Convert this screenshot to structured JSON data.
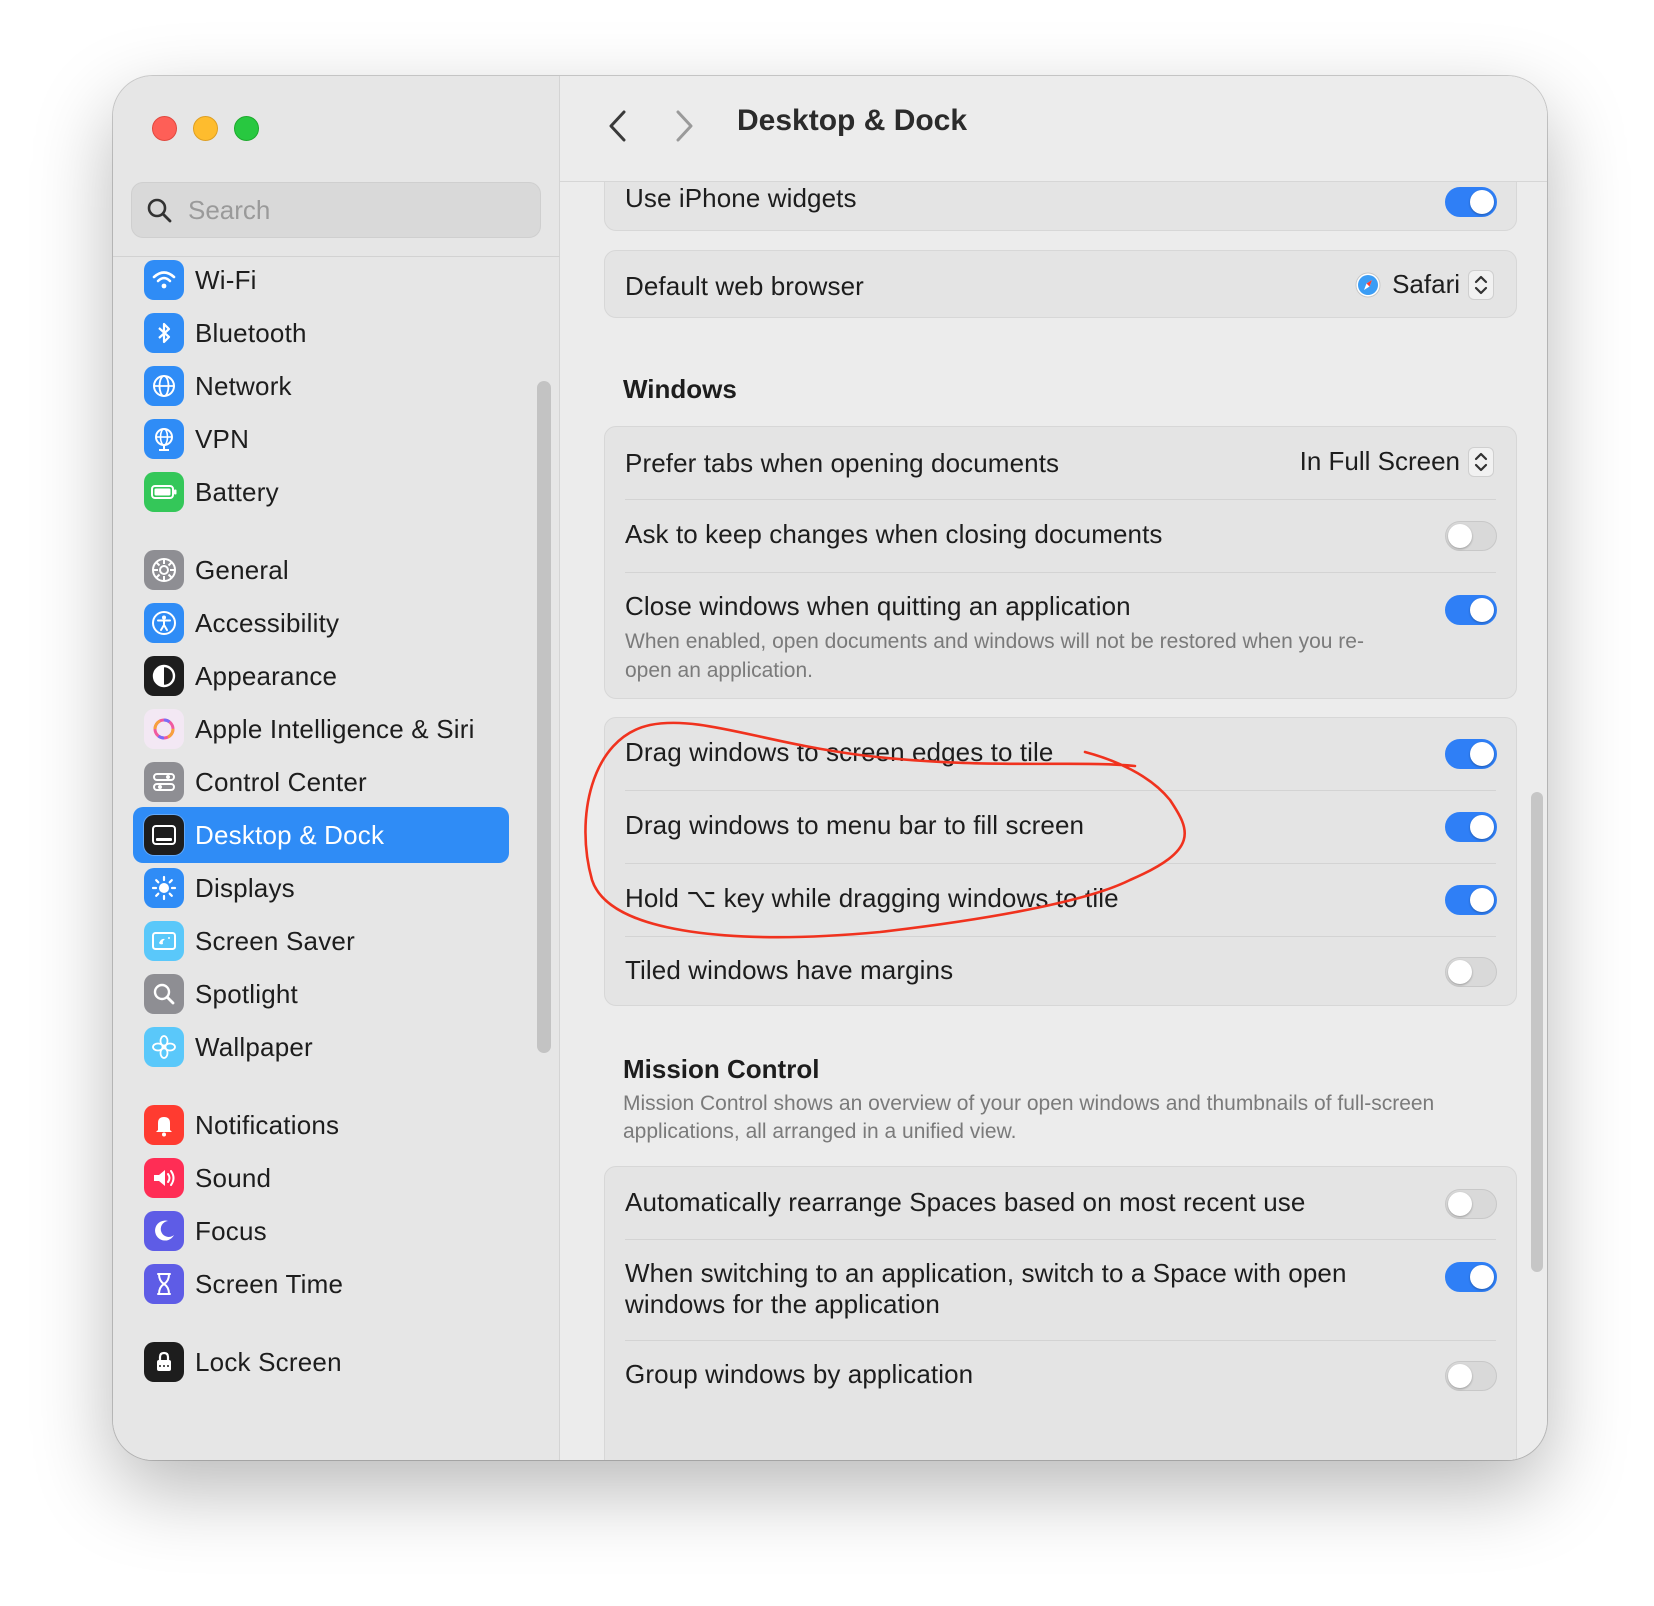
{
  "window": {
    "title": "Desktop & Dock"
  },
  "search": {
    "placeholder": "Search"
  },
  "sidebar": {
    "items": [
      {
        "label": "Wi-Fi",
        "icon": "wifi-icon",
        "color": "#2f8cf6"
      },
      {
        "label": "Bluetooth",
        "icon": "bluetooth-icon",
        "color": "#2f8cf6"
      },
      {
        "label": "Network",
        "icon": "globe-icon",
        "color": "#2f8cf6"
      },
      {
        "label": "VPN",
        "icon": "vpn-globe-icon",
        "color": "#2f8cf6"
      },
      {
        "label": "Battery",
        "icon": "battery-icon",
        "color": "#34c759"
      },
      {
        "label": "General",
        "icon": "gear-icon",
        "color": "#8e8e93"
      },
      {
        "label": "Accessibility",
        "icon": "accessibility-icon",
        "color": "#2f8cf6"
      },
      {
        "label": "Appearance",
        "icon": "appearance-icon",
        "color": "#1d1d1d"
      },
      {
        "label": "Apple Intelligence & Siri",
        "icon": "siri-icon",
        "color": "#e9d3f0"
      },
      {
        "label": "Control Center",
        "icon": "control-center-icon",
        "color": "#8e8e93"
      },
      {
        "label": "Desktop & Dock",
        "icon": "dock-icon",
        "color": "#1d1d1d",
        "selected": true
      },
      {
        "label": "Displays",
        "icon": "sun-icon",
        "color": "#2f8cf6"
      },
      {
        "label": "Screen Saver",
        "icon": "screen-saver-icon",
        "color": "#5ac8fa"
      },
      {
        "label": "Spotlight",
        "icon": "magnifier-icon",
        "color": "#8e8e93"
      },
      {
        "label": "Wallpaper",
        "icon": "flower-icon",
        "color": "#5ac8fa"
      },
      {
        "label": "Notifications",
        "icon": "bell-icon",
        "color": "#ff3b30"
      },
      {
        "label": "Sound",
        "icon": "speaker-icon",
        "color": "#ff2d55"
      },
      {
        "label": "Focus",
        "icon": "moon-icon",
        "color": "#5e5ce6"
      },
      {
        "label": "Screen Time",
        "icon": "hourglass-icon",
        "color": "#5e5ce6"
      },
      {
        "label": "Lock Screen",
        "icon": "lock-icon",
        "color": "#1d1d1d"
      }
    ]
  },
  "rows": {
    "iphone_widgets": {
      "label": "Use iPhone widgets",
      "on": true
    },
    "browser": {
      "label": "Default web browser",
      "value": "Safari"
    },
    "prefer_tabs": {
      "label": "Prefer tabs when opening documents",
      "value": "In Full Screen"
    },
    "ask_keep": {
      "label": "Ask to keep changes when closing documents",
      "on": false
    },
    "close_windows": {
      "label": "Close windows when quitting an application",
      "desc": "When enabled, open documents and windows will not be restored when you re-open an application.",
      "on": true
    },
    "drag_edges": {
      "label": "Drag windows to screen edges to tile",
      "on": true
    },
    "drag_menubar": {
      "label": "Drag windows to menu bar to fill screen",
      "on": true
    },
    "hold_key": {
      "label": "Hold ⌥ key while dragging windows to tile",
      "on": true
    },
    "tiled_margins": {
      "label": "Tiled windows have margins",
      "on": false
    },
    "auto_rearrange": {
      "label": "Automatically rearrange Spaces based on most recent use",
      "on": false
    },
    "switch_space": {
      "label": "When switching to an application, switch to a Space with open windows for the application",
      "on": true
    },
    "group_windows": {
      "label": "Group windows by application",
      "on": false
    }
  },
  "sections": {
    "windows": {
      "title": "Windows"
    },
    "mission_control": {
      "title": "Mission Control",
      "desc": "Mission Control shows an overview of your open windows and thumbnails of full-screen applications, all arranged in a unified view."
    }
  },
  "colors": {
    "accent": "#2f7ff6",
    "annotation": "#f0321e"
  }
}
